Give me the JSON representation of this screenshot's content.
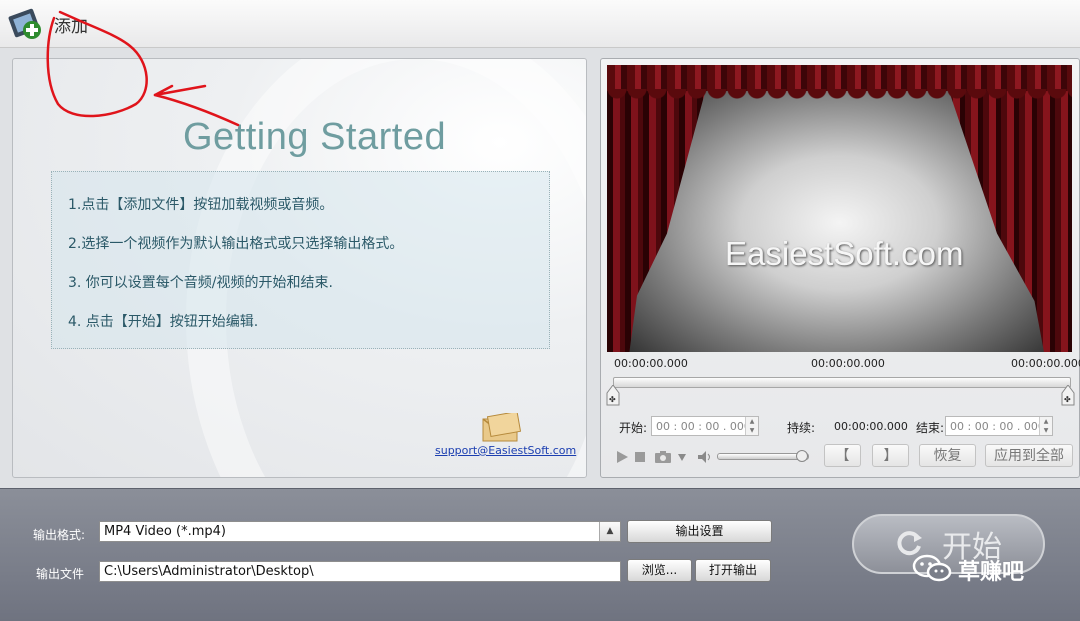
{
  "toolbar": {
    "add_label": "添加"
  },
  "getting_started": {
    "title": "Getting Started",
    "steps": [
      "1.点击【添加文件】按钮加载视频或音频。",
      "2.选择一个视频作为默认输出格式或只选择输出格式。",
      "3. 你可以设置每个音频/视频的开始和结束.",
      "4. 点击【开始】按钮开始编辑."
    ],
    "support_email": "support@EasiestSoft.com"
  },
  "preview": {
    "watermark": "EasiestSoft.com",
    "time_left": "00:00:00.000",
    "time_mid": "00:00:00.000",
    "time_right": "00:00:00.000",
    "start_label": "开始:",
    "start_value": "00 : 00 : 00 . 000",
    "duration_label": "持续:",
    "duration_value": "00:00:00.000",
    "end_label": "结束:",
    "end_value": "00 : 00 : 00 . 000",
    "bracket_left": "【",
    "bracket_right": "】",
    "restore_label": "恢复",
    "apply_all_label": "应用到全部"
  },
  "output": {
    "format_label": "输出格式:",
    "format_value": "MP4 Video (*.mp4)",
    "settings_label": "输出设置",
    "file_label": "输出文件",
    "file_value": "C:\\Users\\Administrator\\Desktop\\",
    "browse_label": "浏览...",
    "open_label": "打开输出",
    "start_label": "开始"
  },
  "overlay": {
    "wechat_text": "草赚吧"
  },
  "colors": {
    "accent_title": "#6f9da0",
    "step_text": "#2b5968",
    "annotation_red": "#e0141b"
  }
}
